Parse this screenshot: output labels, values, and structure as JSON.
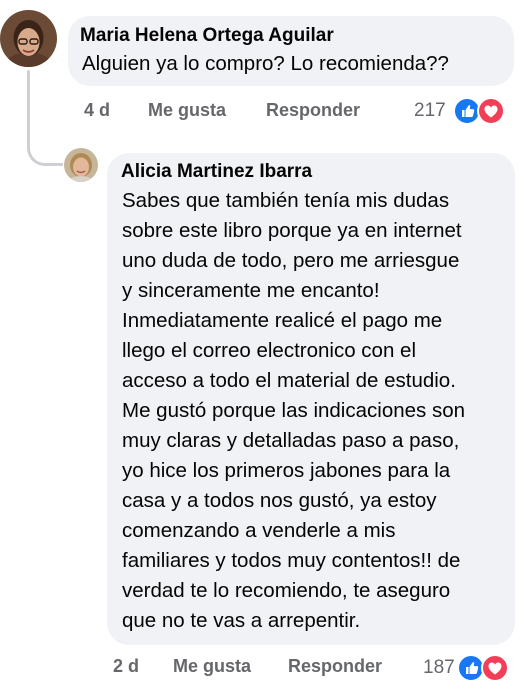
{
  "comment": {
    "author": "Maria Helena Ortega Aguilar",
    "text": "Alguien ya lo compro? Lo recomienda??",
    "age": "4 d",
    "like_label": "Me gusta",
    "reply_label": "Responder",
    "reaction_count": "217",
    "reactions": [
      "like-icon",
      "love-icon"
    ]
  },
  "reply": {
    "author": "Alicia Martinez Ibarra",
    "lines": [
      "Sabes que también tenía mis dudas",
      "sobre este libro porque ya en internet",
      "uno duda de todo, pero me arriesgue",
      "y sinceramente me encanto!",
      "Inmediatamente realicé el pago me",
      "llego el correo electronico con el",
      "acceso a todo el material de estudio.",
      "Me gustó porque las indicaciones son",
      "muy claras y detalladas paso a paso,",
      "yo hice los primeros jabones para la",
      "casa y a todos nos gustó, ya estoy",
      "comenzando a venderle a mis",
      "familiares y todos muy contentos!! de",
      "verdad te lo recomiendo, te aseguro",
      "que no te vas a arrepentir."
    ],
    "age": "2 d",
    "like_label": "Me gusta",
    "reply_label": "Responder",
    "reaction_count": "187",
    "reactions": [
      "like-icon",
      "love-icon"
    ]
  },
  "colors": {
    "bubble": "#f0f2f5",
    "secondary_text": "#65676b",
    "like_blue": "#1877f2",
    "love_red": "#f33e58"
  }
}
